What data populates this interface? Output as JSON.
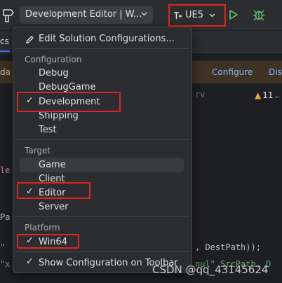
{
  "toolbar": {
    "config_dropdown": "Development Editor | W...",
    "project_dropdown": "UE5"
  },
  "background": {
    "tab_label": "cs",
    "notification_left": "da",
    "notification_configure": "Configure",
    "notification_dis": "Dis",
    "warning_count": "11",
    "code_fragments": [
      "rv",
      "le",
      "Pa",
      "\"",
      "\"x",
      ", DestPath));",
      "nul\" SrcPath, D"
    ]
  },
  "popup": {
    "edit_configs": "Edit Solution Configurations...",
    "config_header": "Configuration",
    "configs": [
      "Debug",
      "DebugGame",
      "Development",
      "Shipping",
      "Test"
    ],
    "selected_config": "Development",
    "target_header": "Target",
    "targets": [
      "Game",
      "Client",
      "Editor",
      "Server"
    ],
    "selected_target": "Editor",
    "platform_header": "Platform",
    "platforms": [
      "Win64"
    ],
    "selected_platform": "Win64",
    "show_on_toolbar": "Show Configuration on Toolbar",
    "check_mark": "✓"
  },
  "watermark": "CSDN @qq_43145624",
  "colors": {
    "highlight": "#e02424",
    "run": "#5fb865",
    "debug": "#5fb865",
    "accent": "#3574f0"
  }
}
